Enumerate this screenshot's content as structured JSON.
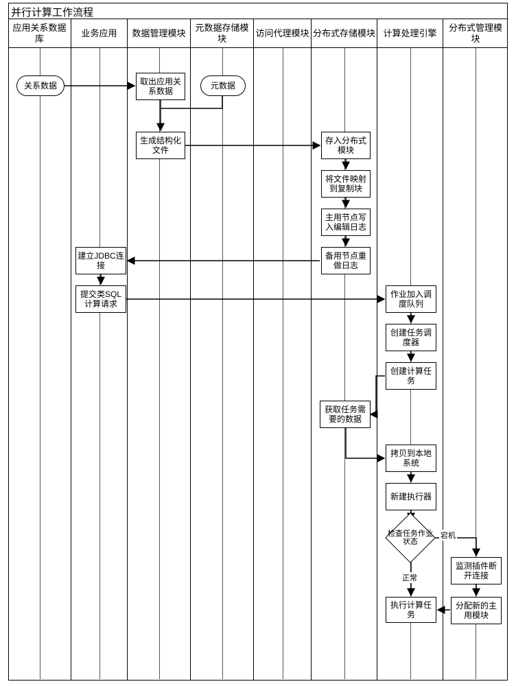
{
  "title": "并行计算工作流程",
  "lanes": [
    "应用关系数据库",
    "业务应用",
    "数据管理模块",
    "元数据存储模块",
    "访问代理模块",
    "分布式存储模块",
    "计算处理引擎",
    "分布式管理模块"
  ],
  "nodes": {
    "d_rel": "关系数据",
    "d_meta": "元数据",
    "n_fetch": "取出应用关系数据",
    "n_gen": "生成结构化文件",
    "n_store": "存入分布式模块",
    "n_map": "将文件映射到复制块",
    "n_mlog": "主用节点写入编辑日志",
    "n_slog": "备用节点重做日志",
    "n_jdbc": "建立JDBC连接",
    "n_sql": "提交类SQL计算请求",
    "n_queue": "作业加入调度队列",
    "n_sched": "创建任务调度器",
    "n_task": "创建计算任务",
    "n_data": "获取任务需要的数据",
    "n_copy": "拷贝到本地系统",
    "n_exec": "新建执行器",
    "n_check": "检查任务作业状态",
    "n_run": "执行计算任务",
    "n_plug": "监测插件断开连接",
    "n_assign": "分配新的主用模块"
  },
  "edge_labels": {
    "normal": "正常",
    "crash": "宕机"
  }
}
